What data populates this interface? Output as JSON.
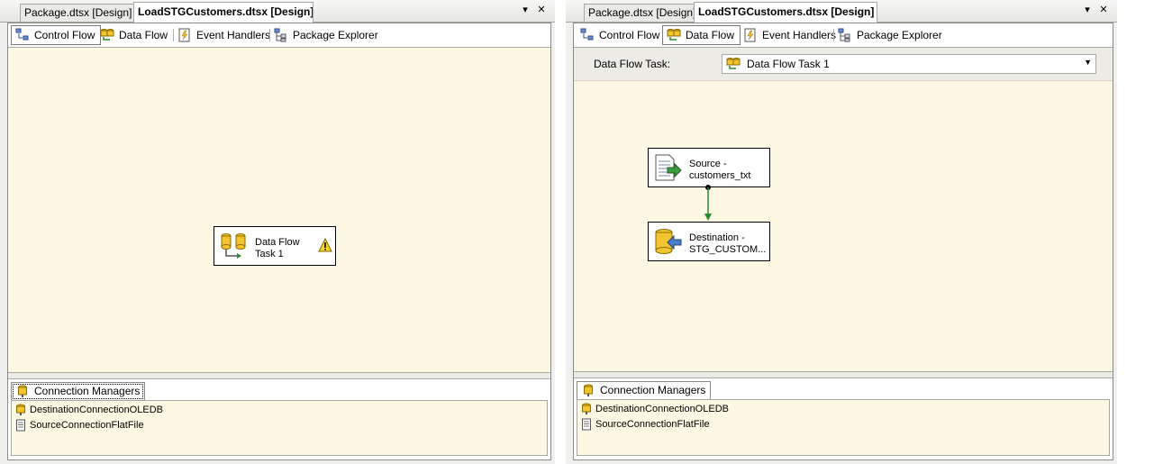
{
  "left_window": {
    "doc_tabs": [
      "Package.dtsx [Design]",
      "LoadSTGCustomers.dtsx [Design]"
    ],
    "designer_tabs": [
      "Control Flow",
      "Data Flow",
      "Event Handlers",
      "Package Explorer"
    ],
    "active_designer_tab": "Control Flow",
    "task": {
      "line1": "Data Flow",
      "line2": "Task 1",
      "warning_icon": "warning-icon"
    },
    "connection_managers": {
      "tab_label": "Connection Managers",
      "items": [
        "DestinationConnectionOLEDB",
        "SourceConnectionFlatFile"
      ]
    }
  },
  "right_window": {
    "doc_tabs": [
      "Package.dtsx [Design]",
      "LoadSTGCustomers.dtsx [Design]"
    ],
    "designer_tabs": [
      "Control Flow",
      "Data Flow",
      "Event Handlers",
      "Package Explorer"
    ],
    "active_designer_tab": "Data Flow",
    "data_flow_task": {
      "label": "Data Flow Task:",
      "value": "Data Flow Task 1"
    },
    "source": {
      "line1": "Source -",
      "line2": "customers_txt"
    },
    "destination": {
      "line1": "Destination -",
      "line2": "STG_CUSTOM..."
    },
    "connection_managers": {
      "tab_label": "Connection Managers",
      "items": [
        "DestinationConnectionOLEDB",
        "SourceConnectionFlatFile"
      ]
    }
  },
  "window_buttons": {
    "dropdown": "▾",
    "close": "✕"
  },
  "colors": {
    "canvas": "#fdf8e3",
    "connector": "#2c8a2c"
  }
}
